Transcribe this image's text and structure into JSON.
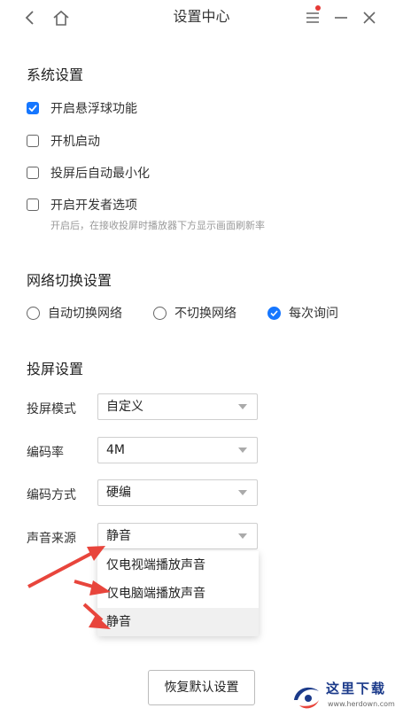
{
  "window": {
    "title": "设置中心",
    "back_icon": "chevron-left-icon",
    "home_icon": "home-icon",
    "menu_icon": "menu-icon",
    "minimize_icon": "minimize-icon",
    "close_icon": "close-icon",
    "notification_color": "#e53935"
  },
  "system": {
    "heading": "系统设置",
    "options": [
      {
        "label": "开启悬浮球功能",
        "checked": true
      },
      {
        "label": "开机启动",
        "checked": false
      },
      {
        "label": "投屏后自动最小化",
        "checked": false
      },
      {
        "label": "开启开发者选项",
        "checked": false
      }
    ],
    "dev_hint": "开启后，在接收投屏时播放器下方显示画面刷新率"
  },
  "network": {
    "heading": "网络切换设置",
    "options": [
      {
        "label": "自动切换网络",
        "checked": false
      },
      {
        "label": "不切换网络",
        "checked": false
      },
      {
        "label": "每次询问",
        "checked": true
      }
    ]
  },
  "cast": {
    "heading": "投屏设置",
    "fields": [
      {
        "label": "投屏模式",
        "value": "自定义"
      },
      {
        "label": "编码率",
        "value": "4M"
      },
      {
        "label": "编码方式",
        "value": "硬编"
      },
      {
        "label": "声音来源",
        "value": "静音"
      }
    ],
    "sound_options": [
      "仅电视端播放声音",
      "仅电脑端播放声音",
      "静音"
    ],
    "sound_selected_index": 2
  },
  "reset_button": "恢复默认设置",
  "accent_color": "#1677ff",
  "annotation_arrow_color": "#e8453c",
  "watermark": {
    "text": "这里下载",
    "url": "www.herdown.com"
  }
}
